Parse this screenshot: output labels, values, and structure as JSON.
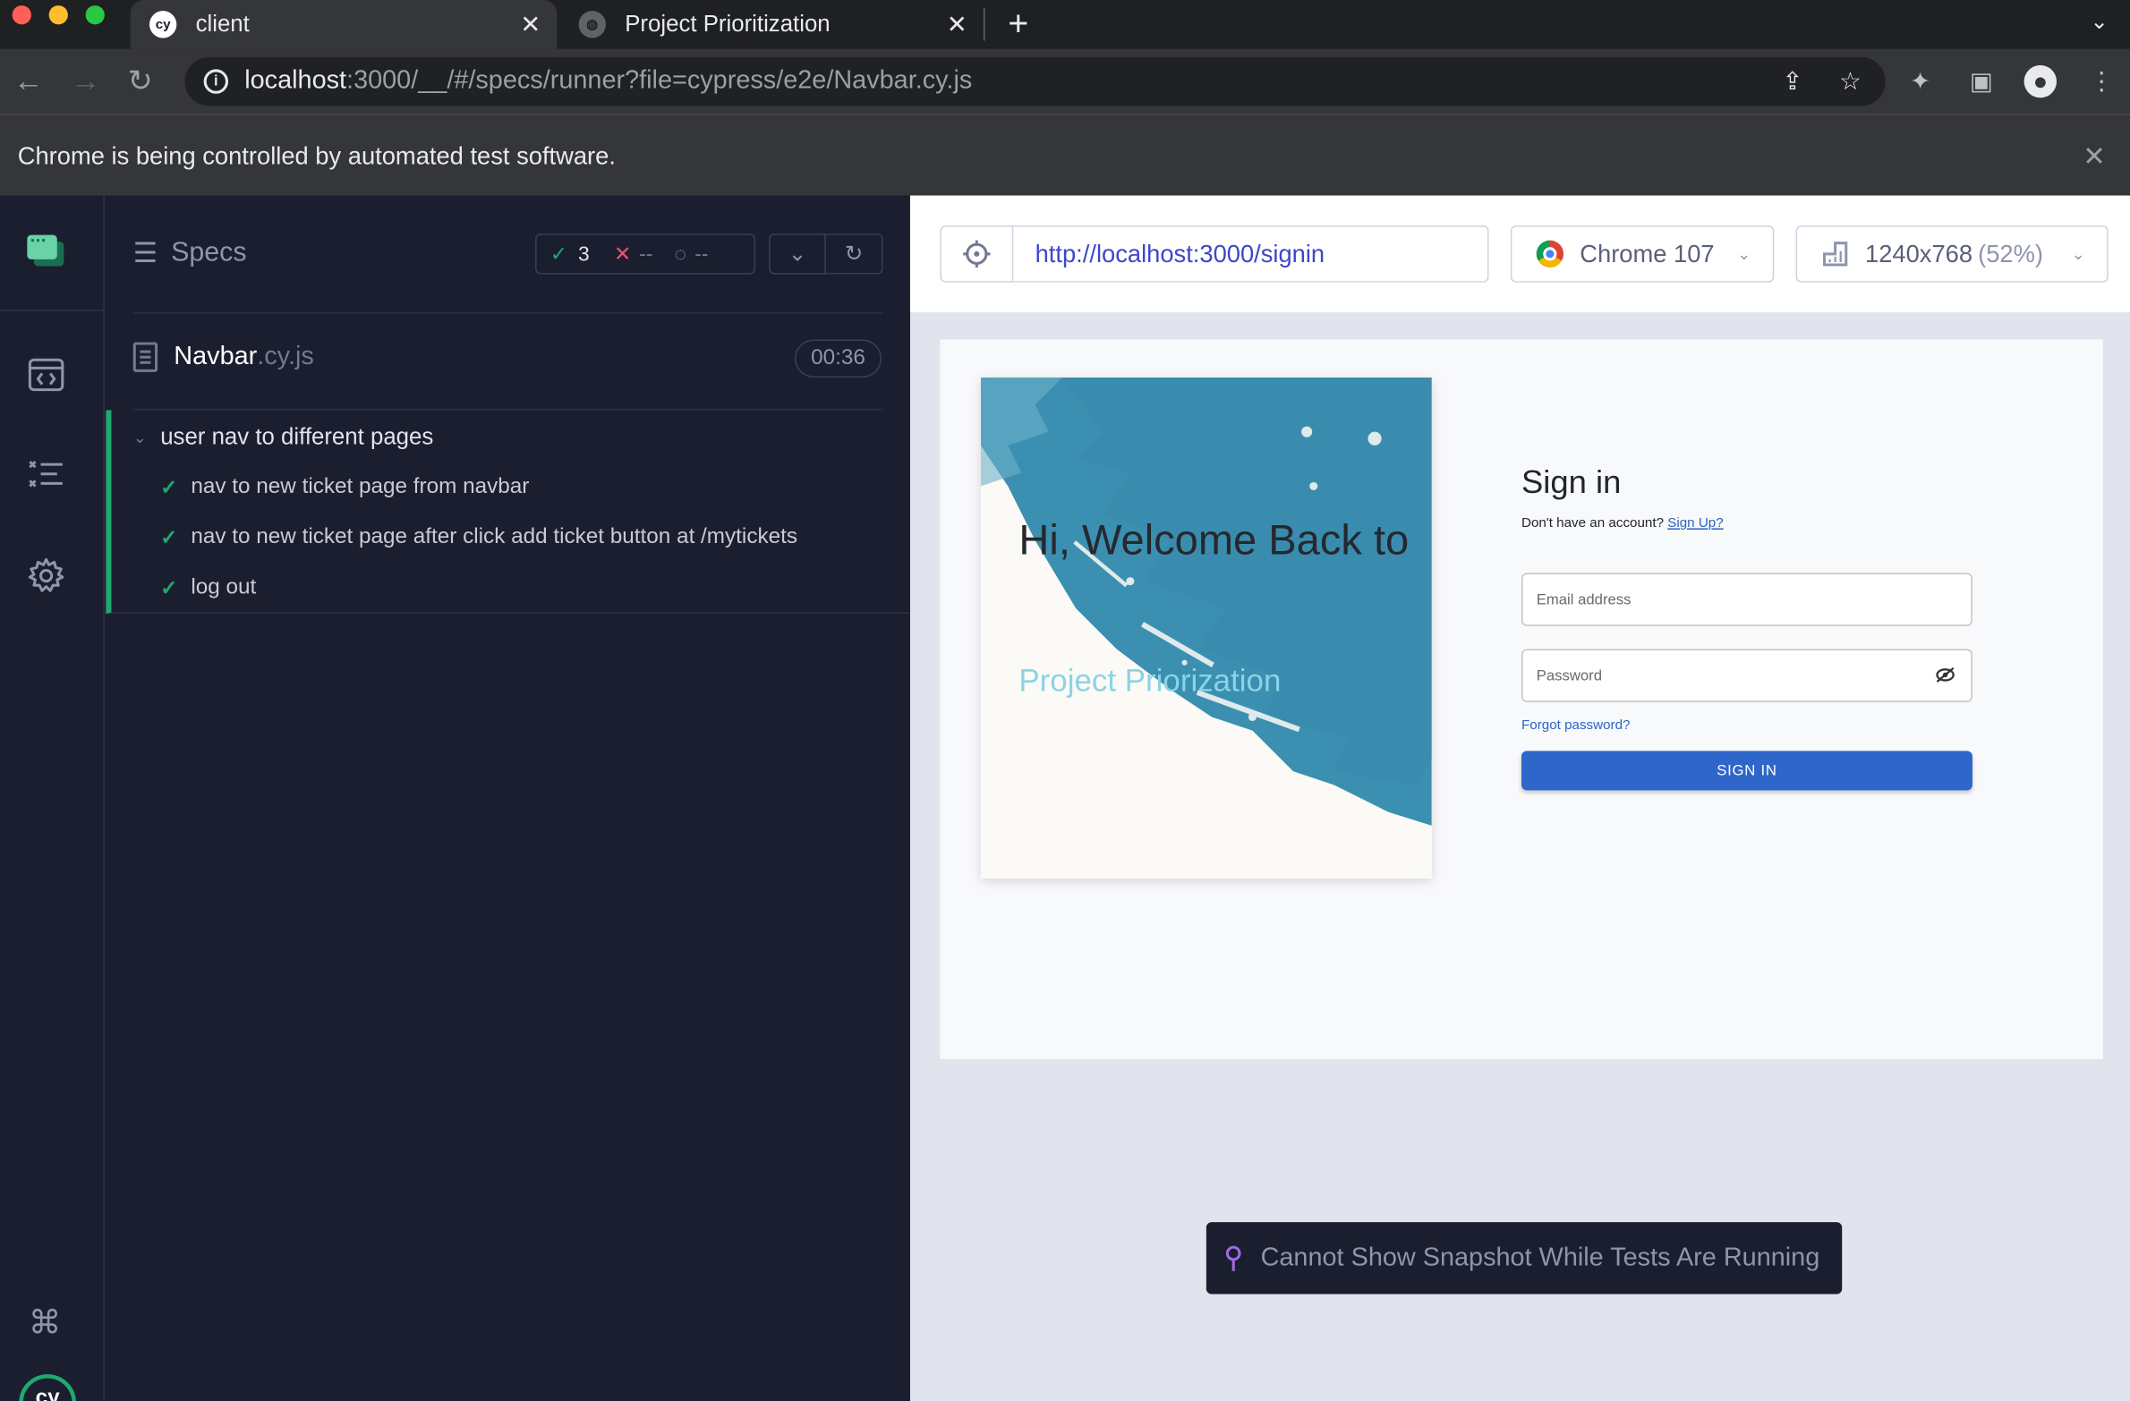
{
  "browser": {
    "tabs": [
      {
        "title": "client",
        "active": true
      },
      {
        "title": "Project Prioritization",
        "active": false
      }
    ],
    "url_host": "localhost",
    "url_rest": ":3000/__/#/specs/runner?file=cypress/e2e/Navbar.cy.js",
    "infobar_text": "Chrome is being controlled by automated test software."
  },
  "reporter": {
    "specs_label": "Specs",
    "passed_count": "3",
    "failed_count": "--",
    "pending_count": "--",
    "spec_name": "Navbar",
    "spec_ext": ".cy.js",
    "duration": "00:36",
    "suite_title": "user nav to different pages",
    "tests": [
      "nav to new ticket page from navbar",
      "nav to new ticket page after click add ticket button at /mytickets",
      "log out"
    ]
  },
  "aut": {
    "url": "http://localhost:3000/signin",
    "browser_name": "Chrome 107",
    "viewport": "1240x768",
    "viewport_scale": "(52%)",
    "snapshot_message": "Cannot Show Snapshot While Tests Are Running"
  },
  "app": {
    "hero_title": "Hi, Welcome Back to",
    "hero_subtitle": "Project Priorization",
    "signin_title": "Sign in",
    "signup_prompt": "Don't have an account?",
    "signup_link": "Sign Up?",
    "email_placeholder": "Email address",
    "password_placeholder": "Password",
    "forgot_link": "Forgot password?",
    "signin_button": "SIGN IN"
  },
  "colors": {
    "pass": "#1fa971",
    "fail": "#e45770",
    "accent": "#2f66c9",
    "hero_paint": "#3b8fb0"
  }
}
